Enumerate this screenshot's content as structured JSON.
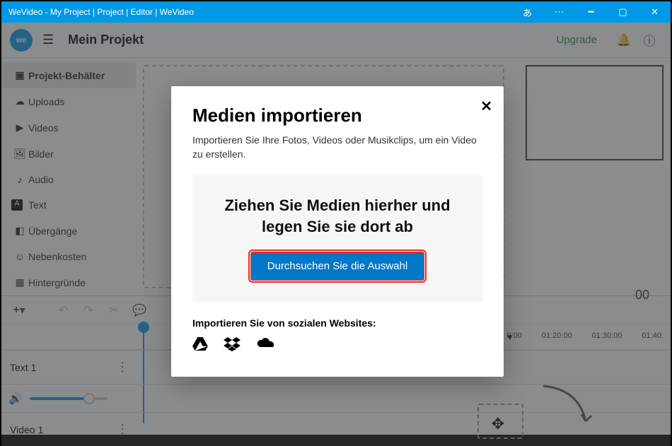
{
  "titlebar": {
    "title": "WeVideo - My Project | Project | Editor | WeVideo",
    "lang": "あ"
  },
  "header": {
    "logo": "we",
    "project": "Mein Projekt",
    "upgrade": "Upgrade"
  },
  "sidebar": {
    "items": [
      {
        "label": "Projekt-Behälter",
        "icon": "▣"
      },
      {
        "label": "Uploads",
        "icon": "☁"
      },
      {
        "label": "Videos",
        "icon": "▶"
      },
      {
        "label": "Bilder",
        "icon": "🖼"
      },
      {
        "label": "Audio",
        "icon": "♪"
      },
      {
        "label": "Text",
        "icon": "A"
      },
      {
        "label": "Übergänge",
        "icon": "◧"
      },
      {
        "label": "Nebenkosten",
        "icon": "☺"
      },
      {
        "label": "Hintergründe",
        "icon": "▦"
      }
    ]
  },
  "timeline": {
    "time_big": "00",
    "times": [
      "0:00",
      "01:20:00",
      "01:30:00",
      "01:40:"
    ],
    "ratio": "▭",
    "tracks": [
      {
        "label": "Text 1"
      },
      {
        "label": "Video 1"
      }
    ]
  },
  "modal": {
    "title": "Medien importieren",
    "desc": "Importieren Sie Ihre Fotos, Videos oder Musikclips, um ein Video zu erstellen.",
    "drop_text": "Ziehen Sie Medien hierher und legen Sie sie dort ab",
    "browse": "Durchsuchen Sie die Auswahl",
    "social_label": "Importieren Sie von sozialen Websites:"
  }
}
